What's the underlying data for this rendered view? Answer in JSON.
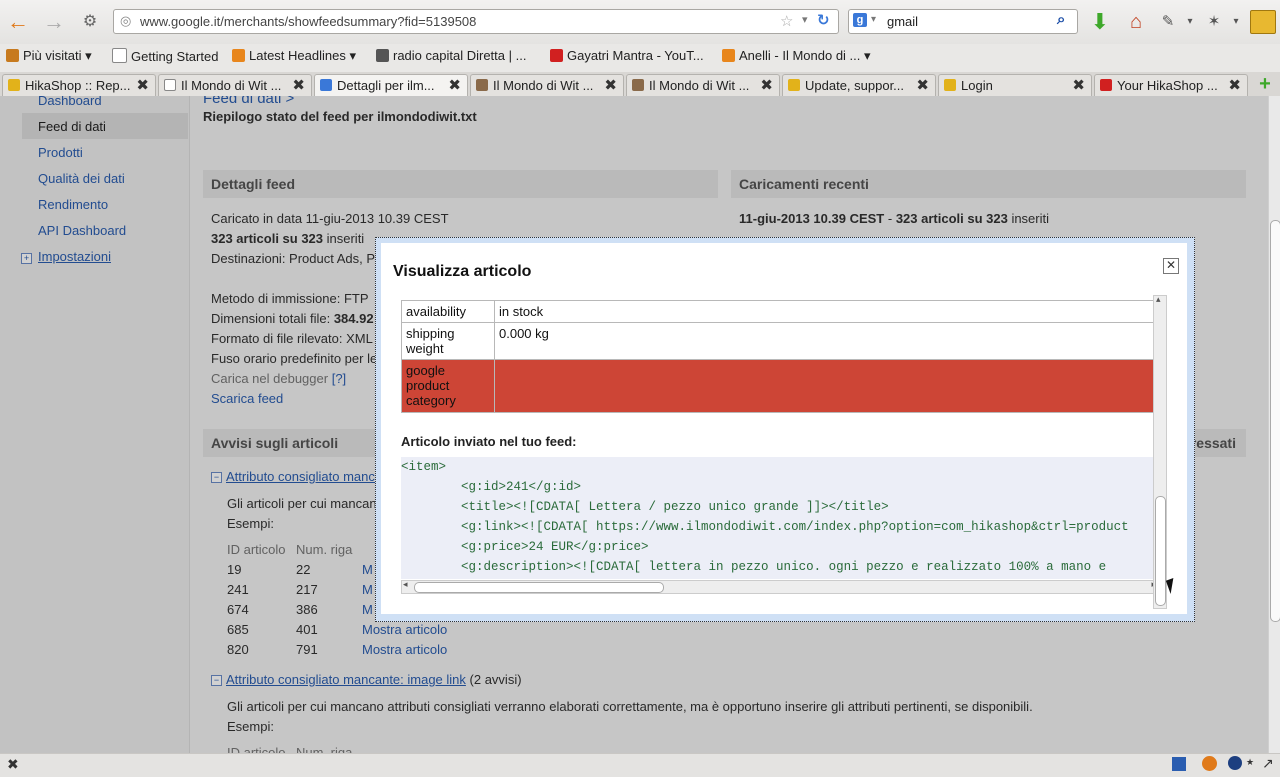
{
  "browser": {
    "url": "www.google.it/merchants/showfeedsummary?fid=5139508",
    "search_query": "gmail",
    "bookmarks": [
      {
        "label": "Più visitati ▾",
        "icon": "gear-icon",
        "color": "#c77a1e"
      },
      {
        "label": "Getting Started",
        "icon": "page-icon",
        "color": "#ffffff"
      },
      {
        "label": "Latest Headlines ▾",
        "icon": "rss-icon",
        "color": "#e8861c"
      },
      {
        "label": "radio capital Diretta | ...",
        "icon": "radio-icon",
        "color": "#555555"
      },
      {
        "label": "Gayatri Mantra - YouT...",
        "icon": "youtube-icon",
        "color": "#d12020"
      },
      {
        "label": "Anelli - Il Mondo di ... ▾",
        "icon": "rss-icon",
        "color": "#e8861c"
      }
    ],
    "tabs": [
      {
        "label": "HikaShop :: Rep...",
        "icon": "hikashop-icon",
        "color": "#e2b21a"
      },
      {
        "label": "Il Mondo di Wit ...",
        "icon": "page-icon",
        "color": "#ffffff"
      },
      {
        "label": "Dettagli per ilm...",
        "icon": "google-icon",
        "color": "#3a78d8",
        "active": true
      },
      {
        "label": "Il Mondo di Wit ...",
        "icon": "witch-icon",
        "color": "#8a6a4a"
      },
      {
        "label": "Il Mondo di Wit ...",
        "icon": "witch-icon",
        "color": "#8a6a4a"
      },
      {
        "label": "Update, suppor...",
        "icon": "hikashop-icon",
        "color": "#e2b21a"
      },
      {
        "label": "Login",
        "icon": "hikashop-icon",
        "color": "#e2b21a"
      },
      {
        "label": "Your HikaShop ...",
        "icon": "gmail-icon",
        "color": "#d12020"
      }
    ]
  },
  "sidebar": {
    "items": [
      {
        "label": "Dashboard"
      },
      {
        "label": "Feed di dati",
        "selected": true
      },
      {
        "label": "Prodotti"
      },
      {
        "label": "Qualità dei dati"
      },
      {
        "label": "Rendimento"
      },
      {
        "label": "API Dashboard"
      },
      {
        "label": "Impostazioni",
        "expandable": true
      }
    ]
  },
  "main": {
    "breadcrumb": "Feed di dati >",
    "title": "Riepilogo stato del feed per ilmondodiwit.txt",
    "details_header": "Dettagli feed",
    "recent_header": "Caricamenti recenti",
    "details": {
      "uploaded": "Caricato in data 11-giu-2013 10.39 CEST",
      "items_bold": "323 articoli su 323",
      "items_rest": " inseriti",
      "destinations": "Destinazioni: Product Ads, P",
      "method": "Metodo di immissione: FTP",
      "size_label": "Dimensioni totali file: ",
      "size_value": "384.92",
      "format": "Formato di file rilevato: XML",
      "timezone": "Fuso orario predefinito per le",
      "debugger": "Carica nel debugger",
      "debugger_help": "[?]",
      "download": "Scarica feed"
    },
    "recent": {
      "date": "11-giu-2013 10.39 CEST",
      "sep": " - ",
      "items_bold": "323 articoli su 323",
      "items_rest": " inseriti"
    },
    "warnings_header": "Avvisi sugli articoli",
    "right_header_fragment": "ressati",
    "warning1": {
      "title": "Attributo consigliato manca",
      "desc": "Gli articoli per cui mancano",
      "examples": "Esempi:",
      "col_id": "ID articolo",
      "col_row": "Num. riga",
      "rows": [
        {
          "id": "19",
          "row": "22",
          "link": "M"
        },
        {
          "id": "241",
          "row": "217",
          "link": "M"
        },
        {
          "id": "674",
          "row": "386",
          "link": "M"
        },
        {
          "id": "685",
          "row": "401",
          "link": "Mostra articolo"
        },
        {
          "id": "820",
          "row": "791",
          "link": "Mostra articolo"
        }
      ]
    },
    "warning2": {
      "title": "Attributo consigliato mancante: image link",
      "count": "(2 avvisi)",
      "desc": "Gli articoli per cui mancano attributi consigliati verranno elaborati correttamente, ma è opportuno inserire gli attributi pertinenti, se disponibili.",
      "examples": "Esempi:",
      "col_id": "ID articolo",
      "col_row": "Num. riga"
    }
  },
  "modal": {
    "title": "Visualizza articolo",
    "attributes": [
      {
        "key": "availability",
        "value": "in stock"
      },
      {
        "key": "shipping weight",
        "value": "0.000 kg"
      },
      {
        "key": "google product category",
        "value": "",
        "error": true
      }
    ],
    "sent_label": "Articolo inviato nel tuo feed:",
    "code_lines": [
      "<item>",
      "        <g:id>241</g:id>",
      "        <title><![CDATA[ Lettera / pezzo unico grande ]]></title>",
      "        <g:link><![CDATA[ https://www.ilmondodiwit.com/index.php?option=com_hikashop&ctrl=product",
      "        <g:price>24 EUR</g:price>",
      "        <g:description><![CDATA[ lettera in pezzo unico. ogni pezzo e realizzato 100% a mano e"
    ]
  }
}
